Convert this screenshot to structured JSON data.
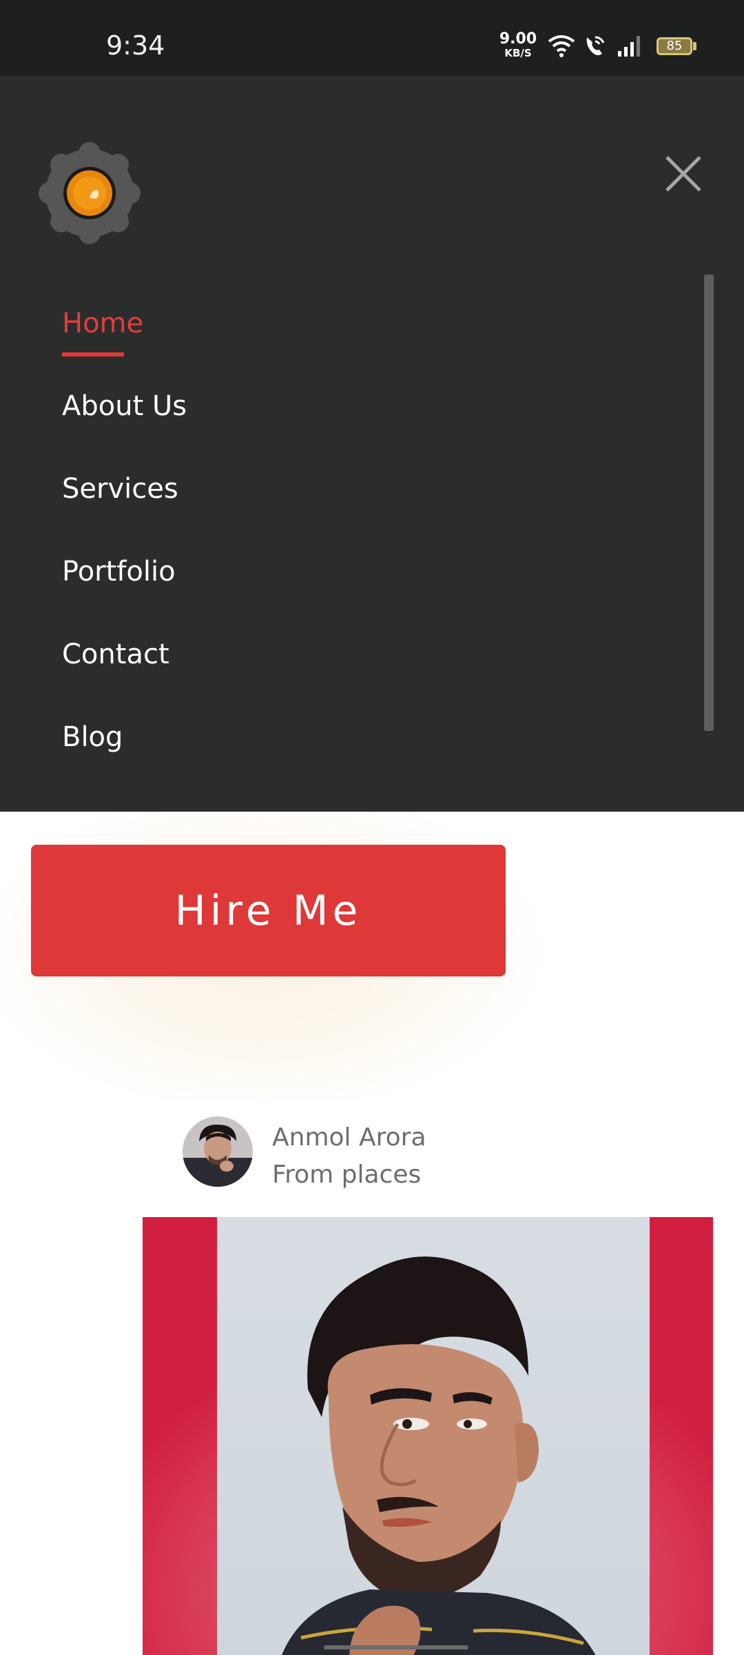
{
  "status_bar": {
    "time": "9:34",
    "net_speed_value": "9.00",
    "net_speed_unit": "KB/S",
    "battery": "85",
    "icons": [
      "wifi-icon",
      "wifi-call-icon",
      "signal-icon",
      "battery-icon"
    ]
  },
  "drawer": {
    "logo_icon": "orange-lens-logo",
    "close_icon": "close-icon",
    "nav_items": [
      {
        "label": "Home",
        "active": true
      },
      {
        "label": "About Us",
        "active": false
      },
      {
        "label": "Services",
        "active": false
      },
      {
        "label": "Portfolio",
        "active": false
      },
      {
        "label": "Contact",
        "active": false
      },
      {
        "label": "Blog",
        "active": false
      }
    ],
    "accent_color": "#e23d3d"
  },
  "hero": {
    "hire_label": "Hire Me",
    "hire_color": "#df3838"
  },
  "post_card": {
    "author": "Anmol Arora",
    "subtitle": "From places"
  }
}
